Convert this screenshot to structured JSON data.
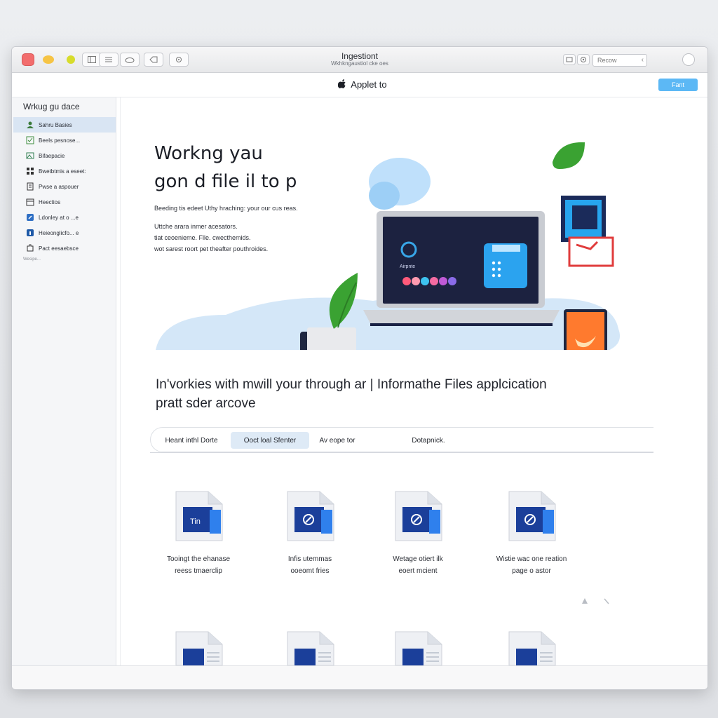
{
  "window": {
    "title": "Ingestiont",
    "subtitle": "Wkhkngaustiol cke oes"
  },
  "toolbar": {
    "search_placeholder": "Recow",
    "search_mark": "‹"
  },
  "nav": {
    "apple_icon": "apple-logo-icon",
    "title": "Applet to",
    "primary_button": "Fant"
  },
  "sidebar": {
    "heading": "Wrkug gu dace",
    "items": [
      {
        "label": "Sahru Basies",
        "icon": "user-icon",
        "active": true
      },
      {
        "label": "Beels pesnose...",
        "icon": "check-icon",
        "active": false
      },
      {
        "label": "Bifaepacie",
        "icon": "image-icon",
        "active": false
      },
      {
        "label": "Bwetbtmis a eseet:",
        "icon": "grid-icon",
        "active": false
      },
      {
        "label": "Pwse a aspouer",
        "icon": "document-icon",
        "active": false
      },
      {
        "label": "Heectios",
        "icon": "calendar-icon",
        "active": false
      },
      {
        "label": "Ldonley at o ...e",
        "icon": "link-icon",
        "active": false
      },
      {
        "label": "Heieonglicfo... e",
        "icon": "info-icon",
        "active": false
      },
      {
        "label": "Pact eesaebsce",
        "icon": "puzzle-icon",
        "active": false
      },
      {
        "label": "Wesipe...",
        "icon": "dots-icon",
        "active": false
      }
    ]
  },
  "hero": {
    "title_line1": "Workng yau",
    "title_line2": "gon d file il to p",
    "desc_lead": "Beeding tis edeet Uthy hraching: your our cus reas.",
    "desc_lines": [
      "Uttche arara inmer acesators.",
      "tiat ceoenieme. Flle. cwecthemids.",
      "wot sarest roort pet theafter pouthroides."
    ],
    "laptop_label": "Airpnte"
  },
  "section": {
    "heading_line1": "In'vorkies with mwill your through ar | Informathe Files applcication",
    "heading_line2": "pratt sder arcove"
  },
  "tabs": [
    {
      "label": "Heant inthl Dorte",
      "active": false
    },
    {
      "label": "Ooct loal Sfenter",
      "active": true
    },
    {
      "label": "Av eope tor",
      "active": false
    },
    {
      "label": "Dotapnick.",
      "active": false
    }
  ],
  "files": [
    {
      "line1": "Tooingt the ehanase",
      "line2": "reess tmaerclip"
    },
    {
      "line1": "Infis utemmas",
      "line2": "ooeomt fries"
    },
    {
      "line1": "Wetage otiert ilk",
      "line2": "eoert mcient"
    },
    {
      "line1": "Wistie wac one reation",
      "line2": "page o astor"
    }
  ],
  "colors": {
    "accent": "#5cb8f5",
    "active_row": "#d9e5f3",
    "file_blue": "#1b3f9a",
    "leaf_green": "#3aa232"
  }
}
